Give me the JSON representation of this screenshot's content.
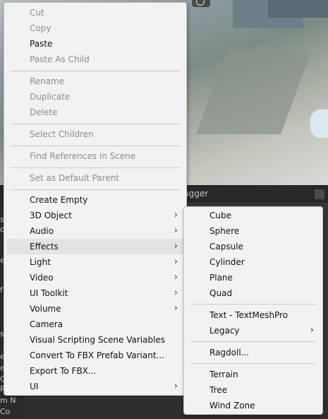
{
  "viewport": {
    "debugger_tab_partial": "ugger",
    "left_panel_fragments": [
      "s",
      "o",
      "e",
      "f",
      "s",
      "e",
      "e",
      "C",
      "R",
      "m N",
      "Co"
    ]
  },
  "context_menu": {
    "items": [
      {
        "label": "Cut",
        "disabled": true
      },
      {
        "label": "Copy",
        "disabled": true
      },
      {
        "label": "Paste",
        "disabled": false
      },
      {
        "label": "Paste As Child",
        "disabled": true
      },
      {
        "label": "Rename",
        "disabled": true
      },
      {
        "label": "Duplicate",
        "disabled": true
      },
      {
        "label": "Delete",
        "disabled": true
      },
      {
        "label": "Select Children",
        "disabled": true
      },
      {
        "label": "Find References in Scene",
        "disabled": true
      },
      {
        "label": "Set as Default Parent",
        "disabled": true
      },
      {
        "label": "Create Empty",
        "disabled": false
      },
      {
        "label": "3D Object",
        "disabled": false,
        "submenu": true
      },
      {
        "label": "Audio",
        "disabled": false,
        "submenu": true
      },
      {
        "label": "Effects",
        "disabled": false,
        "submenu": true,
        "highlighted": true
      },
      {
        "label": "Light",
        "disabled": false,
        "submenu": true
      },
      {
        "label": "Video",
        "disabled": false,
        "submenu": true
      },
      {
        "label": "UI Toolkit",
        "disabled": false,
        "submenu": true
      },
      {
        "label": "Volume",
        "disabled": false,
        "submenu": true
      },
      {
        "label": "Camera",
        "disabled": false
      },
      {
        "label": "Visual Scripting Scene Variables",
        "disabled": false
      },
      {
        "label": "Convert To FBX Prefab Variant...",
        "disabled": false
      },
      {
        "label": "Export To FBX...",
        "disabled": false
      },
      {
        "label": "UI",
        "disabled": false,
        "submenu": true
      }
    ],
    "submenu_arrow": "›"
  },
  "submenu_3d_object": {
    "items": [
      {
        "label": "Cube"
      },
      {
        "label": "Sphere"
      },
      {
        "label": "Capsule"
      },
      {
        "label": "Cylinder"
      },
      {
        "label": "Plane"
      },
      {
        "label": "Quad"
      },
      {
        "label": "Text - TextMeshPro"
      },
      {
        "label": "Legacy",
        "submenu": true
      },
      {
        "label": "Ragdoll..."
      },
      {
        "label": "Terrain"
      },
      {
        "label": "Tree"
      },
      {
        "label": "Wind Zone"
      }
    ]
  }
}
